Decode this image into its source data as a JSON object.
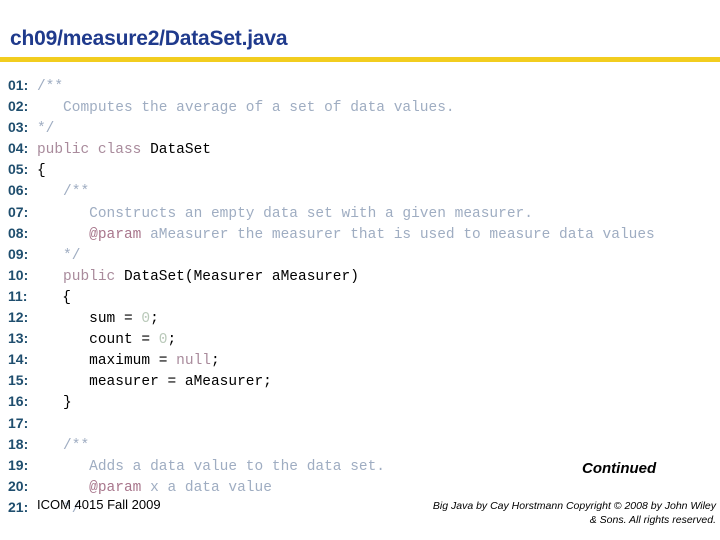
{
  "slide": {
    "title": "ch09/measure2/DataSet.java",
    "title_color": "#1f3a8c",
    "rule_color": "#f2cd1f"
  },
  "code": {
    "language": "java",
    "syntax_colors": {
      "line_number": "#1f4e6e",
      "comment": "#9fadc2",
      "keyword": "#a98b9c",
      "javadoc_tag": "#a8768c",
      "number_literal": "#b9c9b9",
      "identifier": "#000000"
    },
    "lines": [
      {
        "num": "01:",
        "indent": 0,
        "tokens": [
          {
            "t": "/**",
            "c": "cm"
          }
        ]
      },
      {
        "num": "02:",
        "indent": 3,
        "tokens": [
          {
            "t": "Computes the average of a set of data values.",
            "c": "cm"
          }
        ]
      },
      {
        "num": "03:",
        "indent": 0,
        "tokens": [
          {
            "t": "*/",
            "c": "cm"
          }
        ]
      },
      {
        "num": "04:",
        "indent": 0,
        "tokens": [
          {
            "t": "public class ",
            "c": "kw"
          },
          {
            "t": "DataSet",
            "c": "id"
          }
        ]
      },
      {
        "num": "05:",
        "indent": 0,
        "tokens": [
          {
            "t": "{",
            "c": "id"
          }
        ]
      },
      {
        "num": "06:",
        "indent": 3,
        "tokens": [
          {
            "t": "/**",
            "c": "cm"
          }
        ]
      },
      {
        "num": "07:",
        "indent": 6,
        "tokens": [
          {
            "t": "Constructs an empty data set with a given measurer.",
            "c": "cm"
          }
        ]
      },
      {
        "num": "08:",
        "indent": 6,
        "tokens": [
          {
            "t": "@param",
            "c": "tag"
          },
          {
            "t": " aMeasurer the measurer that is used to measure data values",
            "c": "cm"
          }
        ]
      },
      {
        "num": "09:",
        "indent": 3,
        "tokens": [
          {
            "t": "*/",
            "c": "cm"
          }
        ]
      },
      {
        "num": "10:",
        "indent": 3,
        "tokens": [
          {
            "t": "public ",
            "c": "kw"
          },
          {
            "t": "DataSet(Measurer aMeasurer)",
            "c": "id"
          }
        ]
      },
      {
        "num": "11:",
        "indent": 3,
        "tokens": [
          {
            "t": "{",
            "c": "id"
          }
        ]
      },
      {
        "num": "12:",
        "indent": 6,
        "tokens": [
          {
            "t": "sum = ",
            "c": "id"
          },
          {
            "t": "0",
            "c": "num"
          },
          {
            "t": ";",
            "c": "id"
          }
        ]
      },
      {
        "num": "13:",
        "indent": 6,
        "tokens": [
          {
            "t": "count = ",
            "c": "id"
          },
          {
            "t": "0",
            "c": "num"
          },
          {
            "t": ";",
            "c": "id"
          }
        ]
      },
      {
        "num": "14:",
        "indent": 6,
        "tokens": [
          {
            "t": "maximum = ",
            "c": "id"
          },
          {
            "t": "null",
            "c": "kw"
          },
          {
            "t": ";",
            "c": "id"
          }
        ]
      },
      {
        "num": "15:",
        "indent": 6,
        "tokens": [
          {
            "t": "measurer = aMeasurer;",
            "c": "id"
          }
        ]
      },
      {
        "num": "16:",
        "indent": 3,
        "tokens": [
          {
            "t": "}",
            "c": "id"
          }
        ]
      },
      {
        "num": "17:",
        "indent": 0,
        "tokens": []
      },
      {
        "num": "18:",
        "indent": 3,
        "tokens": [
          {
            "t": "/**",
            "c": "cm"
          }
        ]
      },
      {
        "num": "19:",
        "indent": 6,
        "tokens": [
          {
            "t": "Adds a data value to the data set.",
            "c": "cm"
          }
        ]
      },
      {
        "num": "20:",
        "indent": 6,
        "tokens": [
          {
            "t": "@param",
            "c": "tag"
          },
          {
            "t": " x a data value",
            "c": "cm"
          }
        ]
      },
      {
        "num": "21:",
        "indent": 3,
        "tokens": [
          {
            "t": "*/",
            "c": "cm"
          }
        ]
      }
    ]
  },
  "footer": {
    "course": "ICOM 4015 Fall 2009",
    "continued": "Continued",
    "copyright_line1": "Big Java by Cay Horstmann Copyright © 2008 by John Wiley",
    "copyright_line2": "& Sons.  All rights reserved."
  }
}
